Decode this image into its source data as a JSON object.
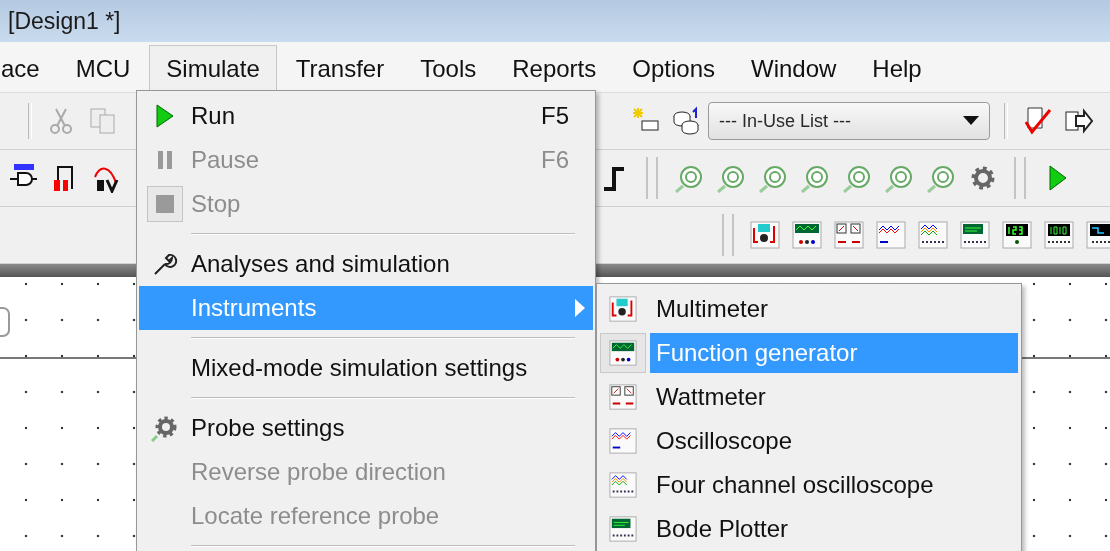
{
  "window": {
    "title": "[Design1 *]"
  },
  "menu_bar": [
    {
      "label": "ace",
      "selected": false
    },
    {
      "label": "MCU",
      "selected": false
    },
    {
      "label": "Simulate",
      "selected": true
    },
    {
      "label": "Transfer",
      "selected": false
    },
    {
      "label": "Tools",
      "selected": false
    },
    {
      "label": "Reports",
      "selected": false
    },
    {
      "label": "Options",
      "selected": false
    },
    {
      "label": "Window",
      "selected": false
    },
    {
      "label": "Help",
      "selected": false
    }
  ],
  "toolbar": {
    "component_list": {
      "value": "--- In-Use List ---"
    }
  },
  "simulate_menu": [
    {
      "kind": "item",
      "label": "Run",
      "shortcut": "F5",
      "disabled": false,
      "selected": false
    },
    {
      "kind": "item",
      "label": "Pause",
      "shortcut": "F6",
      "disabled": true,
      "selected": false
    },
    {
      "kind": "item",
      "label": "Stop",
      "disabled": true,
      "selected": false
    },
    {
      "kind": "separator"
    },
    {
      "kind": "item",
      "label": "Analyses and simulation",
      "disabled": false,
      "selected": false
    },
    {
      "kind": "submenu",
      "label": "Instruments",
      "disabled": false,
      "selected": true
    },
    {
      "kind": "separator"
    },
    {
      "kind": "item",
      "label": "Mixed-mode simulation settings",
      "disabled": false,
      "selected": false
    },
    {
      "kind": "separator"
    },
    {
      "kind": "item",
      "label": "Probe settings",
      "disabled": false,
      "selected": false
    },
    {
      "kind": "item",
      "label": "Reverse probe direction",
      "disabled": true,
      "selected": false
    },
    {
      "kind": "item",
      "label": "Locate reference probe",
      "disabled": true,
      "selected": false
    },
    {
      "kind": "separator"
    }
  ],
  "instruments_submenu": [
    {
      "label": "Multimeter",
      "selected": false
    },
    {
      "label": "Function generator",
      "selected": true
    },
    {
      "label": "Wattmeter",
      "selected": false
    },
    {
      "label": "Oscilloscope",
      "selected": false
    },
    {
      "label": "Four channel oscilloscope",
      "selected": false
    },
    {
      "label": "Bode Plotter",
      "selected": false
    }
  ]
}
